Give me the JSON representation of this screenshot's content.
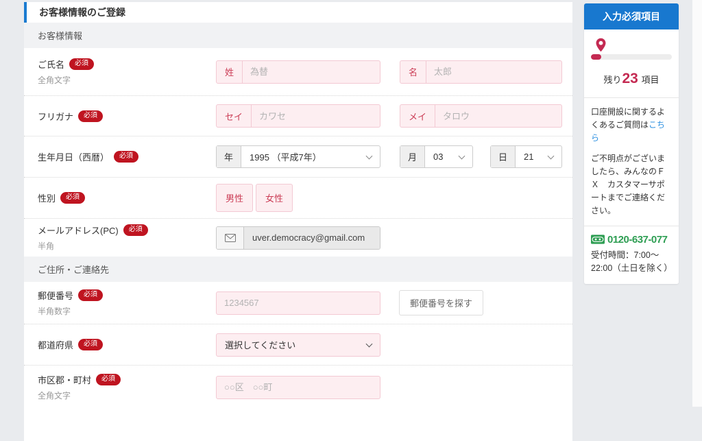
{
  "main": {
    "header_title": "お客様情報のご登録",
    "section1_title": "お客様情報",
    "section2_title": "ご住所・ご連絡先",
    "required_badge": "必須",
    "rows": {
      "name": {
        "label": "ご氏名",
        "hint": "全角文字",
        "last": {
          "prefix": "姓",
          "placeholder": "為替"
        },
        "first": {
          "prefix": "名",
          "placeholder": "太郎"
        }
      },
      "furigana": {
        "label": "フリガナ",
        "last": {
          "prefix": "セイ",
          "placeholder": "カワセ"
        },
        "first": {
          "prefix": "メイ",
          "placeholder": "タロウ"
        }
      },
      "birth": {
        "label": "生年月日（西暦）",
        "year": {
          "prefix": "年",
          "value": "1995 （平成7年）"
        },
        "month": {
          "prefix": "月",
          "value": "03"
        },
        "day": {
          "prefix": "日",
          "value": "21"
        }
      },
      "gender": {
        "label": "性別",
        "male": "男性",
        "female": "女性"
      },
      "email": {
        "label": "メールアドレス(PC)",
        "hint": "半角",
        "value": "uver.democracy@gmail.com"
      },
      "postal": {
        "label": "郵便番号",
        "hint": "半角数字",
        "placeholder": "1234567",
        "search_button": "郵便番号を探す"
      },
      "prefecture": {
        "label": "都道府県",
        "value": "選択してください"
      },
      "city": {
        "label": "市区郡・町村",
        "hint": "全角文字",
        "placeholder": "○○区　○○町"
      }
    }
  },
  "sidebar": {
    "header": "入力必須項目",
    "remaining_prefix": "残り",
    "remaining_count": "23",
    "remaining_suffix": "項目",
    "faq_text_before_link": "口座開設に関するよくあるご質問は",
    "faq_link": "こちら",
    "support_text": "ご不明点がございましたら、みんなのＦＸ　カスタマーサポートまでご連絡ください。",
    "phone": "0120-637-077",
    "hours_line1": "受付時間：7:00〜",
    "hours_line2": "22:00（土日を除く）"
  },
  "colors": {
    "accent_blue": "#1b7bd0",
    "sidebar_blue": "#1878cf",
    "badge_red": "#bf1420",
    "crimson": "#c42a52",
    "pink_bg": "#fdeef1",
    "pink_border": "#f3c9d3",
    "green": "#2e9e53",
    "link_blue": "#2b8fe0"
  }
}
